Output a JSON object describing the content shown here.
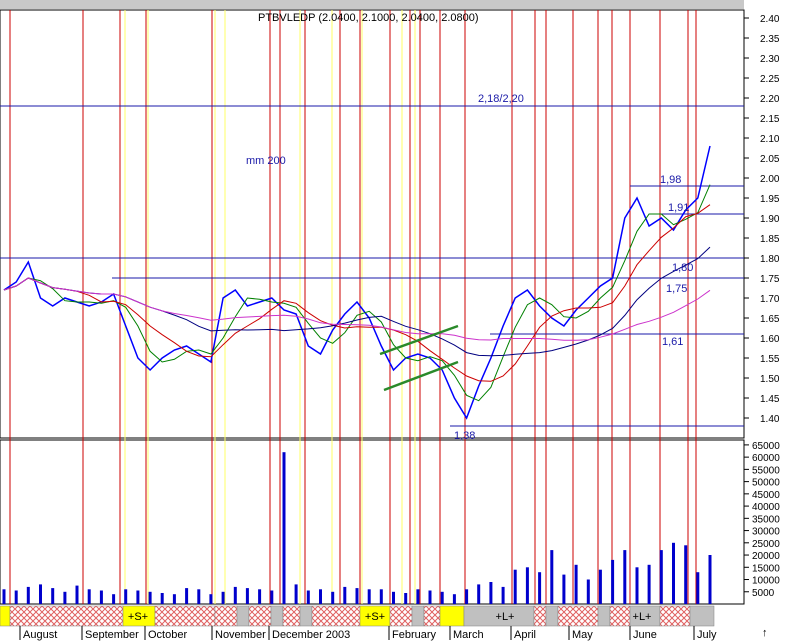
{
  "chart_data": [
    {
      "type": "line",
      "title": "PTBVLEDP (2.0400, 2.1000, 2.0400, 2.0800)",
      "ylim": [
        1.35,
        2.42
      ],
      "y_ticks": [
        "2.40",
        "2.35",
        "2.30",
        "2.25",
        "2.20",
        "2.15",
        "2.10",
        "2.05",
        "2.00",
        "1.95",
        "1.90",
        "1.85",
        "1.80",
        "1.75",
        "1.70",
        "1.65",
        "1.60",
        "1.55",
        "1.50",
        "1.45",
        "1.40"
      ],
      "months": [
        "August",
        "September",
        "October",
        "November",
        "December 2003",
        "February",
        "March",
        "April",
        "May",
        "June",
        "July"
      ],
      "ma_label": "mm 200",
      "horizontal_levels": [
        {
          "label": "2,18/2,20",
          "value": 2.18
        },
        {
          "label": "1,98",
          "value": 1.98
        },
        {
          "label": "1,91",
          "value": 1.91
        },
        {
          "label": "1,80",
          "value": 1.8
        },
        {
          "label": "1,75",
          "value": 1.75
        },
        {
          "label": "1,61",
          "value": 1.61
        },
        {
          "label": "1,38",
          "value": 1.38
        }
      ],
      "series": [
        {
          "name": "",
          "color": "#0000ff",
          "values": [
            1.72,
            1.74,
            1.79,
            1.7,
            1.68,
            1.7,
            1.69,
            1.68,
            1.69,
            1.71,
            1.63,
            1.55,
            1.52,
            1.55,
            1.57,
            1.58,
            1.56,
            1.54,
            1.7,
            1.72,
            1.68,
            1.69,
            1.7,
            1.67,
            1.66,
            1.58,
            1.56,
            1.62,
            1.66,
            1.69,
            1.65,
            1.58,
            1.52,
            1.55,
            1.56,
            1.55,
            1.52,
            1.45,
            1.4,
            1.48,
            1.55,
            1.63,
            1.7,
            1.72,
            1.68,
            1.65,
            1.63,
            1.67,
            1.7,
            1.73,
            1.75,
            1.9,
            1.95,
            1.88,
            1.9,
            1.87,
            1.92,
            1.95,
            2.08
          ]
        }
      ]
    },
    {
      "type": "bar",
      "title": "",
      "ylim": [
        0,
        67000
      ],
      "y_ticks": [
        "65000",
        "60000",
        "55000",
        "50000",
        "45000",
        "40000",
        "35000",
        "30000",
        "25000",
        "20000",
        "15000",
        "10000",
        "5000"
      ],
      "values": [
        6000,
        5500,
        7000,
        8000,
        6500,
        5000,
        7500,
        6000,
        5500,
        4000,
        6000,
        5500,
        5000,
        4500,
        4000,
        6500,
        6000,
        4000,
        5000,
        7000,
        6500,
        6000,
        5500,
        62000,
        8000,
        5500,
        6000,
        5000,
        7000,
        6500,
        6000,
        6000,
        5000,
        4500,
        6000,
        5500,
        5000,
        4000,
        6000,
        8000,
        9000,
        7000,
        14000,
        15000,
        13000,
        22000,
        12000,
        16000,
        10000,
        14000,
        18000,
        22000,
        15000,
        16000,
        22000,
        25000,
        24000,
        13000,
        20000
      ]
    }
  ],
  "band": {
    "signals": [
      "+S+",
      "+S+",
      "+L+",
      "+L+"
    ]
  }
}
